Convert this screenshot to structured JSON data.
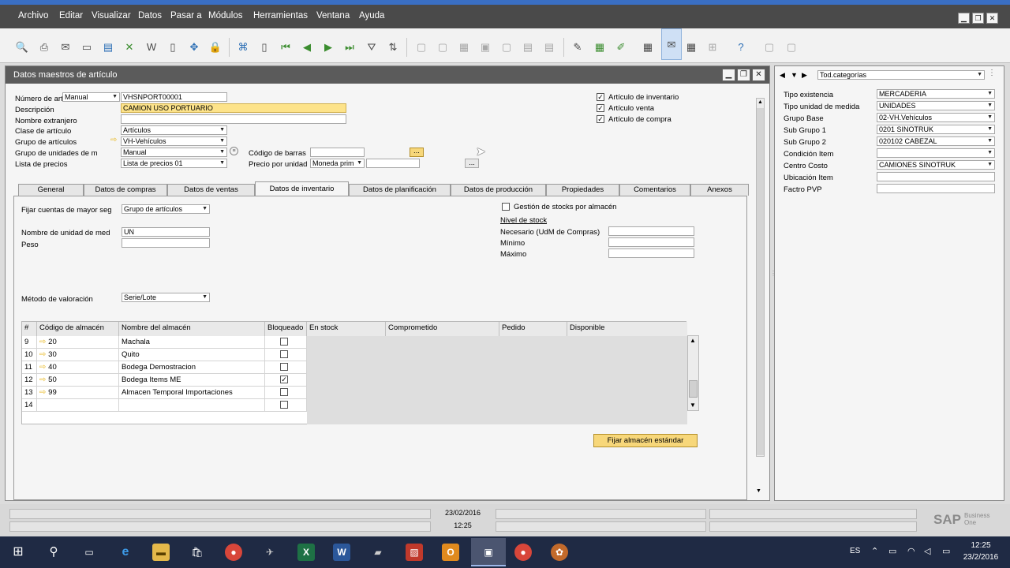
{
  "menu": [
    "Archivo",
    "Editar",
    "Visualizar",
    "Datos",
    "Pasar a",
    "Módulos",
    "Herramientas",
    "Ventana",
    "Ayuda"
  ],
  "window": {
    "title": "Datos maestros de artículo"
  },
  "header_fields": {
    "item_number_label": "Número de art",
    "item_number_series": "Manual",
    "item_number_value": "VHSNPORT00001",
    "description_label": "Descripción",
    "description_value": "CAMION USO PORTUARIO",
    "foreign_name_label": "Nombre extranjero",
    "foreign_name_value": "",
    "item_type_label": "Clase de artículo",
    "item_type_value": "Artículos",
    "item_group_label": "Grupo de artículos",
    "item_group_value": "VH-Vehículos",
    "uom_group_label": "Grupo de unidades de m",
    "uom_group_value": "Manual",
    "price_list_label": "Lista de precios",
    "price_list_value": "Lista de precios 01",
    "barcode_label": "Código de barras",
    "barcode_value": "",
    "unit_price_label": "Precio por unidad",
    "unit_price_currency": "Moneda prim",
    "unit_price_value": "",
    "ellipsis": "...",
    "chk_inventory": "Artículo de inventario",
    "chk_sales": "Artículo venta",
    "chk_purchase": "Artículo de compra"
  },
  "tabs": [
    "General",
    "Datos de compras",
    "Datos de ventas",
    "Datos de inventario",
    "Datos de planificación",
    "Datos de producción",
    "Propiedades",
    "Comentarios",
    "Anexos"
  ],
  "inventory": {
    "gl_label": "Fijar cuentas de mayor seg",
    "gl_value": "Grupo de artículos",
    "uom_name_label": "Nombre de unidad de med",
    "uom_name_value": "UN",
    "weight_label": "Peso",
    "weight_value": "",
    "valuation_label": "Método de valoración",
    "valuation_value": "Serie/Lote",
    "manage_stock_label": "Gestión de stocks por almacén",
    "stock_level_label": "Nivel de stock",
    "required_label": "Necesario (UdM de Compras)",
    "min_label": "Mínimo",
    "max_label": "Máximo",
    "set_default_button": "Fijar almacén estándar"
  },
  "grid": {
    "headers": [
      "#",
      "Código de almacén",
      "Nombre del almacén",
      "Bloqueado",
      "En stock",
      "Comprometido",
      "Pedido",
      "Disponible"
    ],
    "rows": [
      {
        "n": "9",
        "code": "20",
        "name": "Machala",
        "locked": false
      },
      {
        "n": "10",
        "code": "30",
        "name": "Quito",
        "locked": false
      },
      {
        "n": "11",
        "code": "40",
        "name": "Bodega Demostracion",
        "locked": false
      },
      {
        "n": "12",
        "code": "50",
        "name": "Bodega Items ME",
        "locked": true
      },
      {
        "n": "13",
        "code": "99",
        "name": "Almacen Temporal Importaciones",
        "locked": false
      },
      {
        "n": "14",
        "code": "",
        "name": "",
        "locked": false
      }
    ]
  },
  "right_panel": {
    "nav_label": "Tod.categorías",
    "fields": [
      {
        "label": "Tipo existencia",
        "value": "MERCADERIA",
        "dropdown": true
      },
      {
        "label": "Tipo unidad de medida",
        "value": "UNIDADES",
        "dropdown": true
      },
      {
        "label": "Grupo Base",
        "value": "02-VH.Vehículos",
        "dropdown": true
      },
      {
        "label": "Sub Grupo 1",
        "value": "0201 SINOTRUK",
        "dropdown": true
      },
      {
        "label": "Sub Grupo 2",
        "value": "020102 CABEZAL",
        "dropdown": true
      },
      {
        "label": "Condición Item",
        "value": "",
        "dropdown": true
      },
      {
        "label": "Centro Costo",
        "value": "CAMIONES SINOTRUK",
        "dropdown": true
      },
      {
        "label": "Ubicación Item",
        "value": "",
        "dropdown": false
      },
      {
        "label": "Factro PVP",
        "value": "",
        "dropdown": false
      }
    ]
  },
  "status": {
    "date": "23/02/2016",
    "time": "12:25",
    "brand_sap": "SAP",
    "brand_b1": "Business One"
  },
  "taskbar": {
    "lang": "ES",
    "clock_time": "12:25",
    "clock_date": "23/2/2016"
  }
}
